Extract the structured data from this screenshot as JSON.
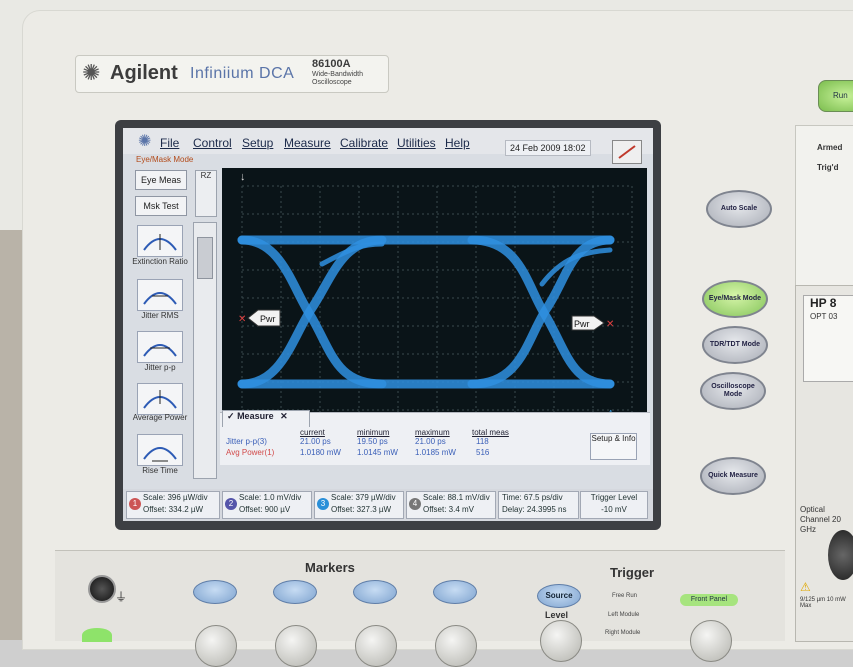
{
  "brand": {
    "company": "Agilent",
    "line": "Infiniium DCA",
    "model": "86100A",
    "model_desc": "Wide-Bandwidth Oscilloscope"
  },
  "menu": [
    "File",
    "Control",
    "Setup",
    "Measure",
    "Calibrate",
    "Utilities",
    "Help"
  ],
  "datetime": "24 Feb 2009  18:02",
  "mode_title": "Eye/Mask Mode",
  "tools": {
    "eye_meas": "Eye Meas",
    "mask_test": "Msk Test"
  },
  "rz_label": "RZ",
  "measure_buttons": [
    {
      "name": "extinction-ratio",
      "label": "Extinction Ratio"
    },
    {
      "name": "jitter-rms",
      "label": "Jitter RMS"
    },
    {
      "name": "jitter-pp",
      "label": "Jitter p-p"
    },
    {
      "name": "average-power",
      "label": "Average Power"
    },
    {
      "name": "rise-time",
      "label": "Rise Time"
    }
  ],
  "plot": {
    "pwr_marker": "Pwr",
    "trace_color": "#2f8fe0",
    "background": "#0a1418"
  },
  "measure_panel": {
    "tab": "Measure",
    "headers": [
      "current",
      "minimum",
      "maximum",
      "total meas"
    ],
    "rows": [
      {
        "label": "Jitter p-p(3)",
        "current": "21.00 ps",
        "minimum": "19.50 ps",
        "maximum": "21.00 ps",
        "total": "118",
        "color": "#3a5fb8"
      },
      {
        "label": "Avg Power(1)",
        "current": "1.0180 mW",
        "minimum": "1.0145 mW",
        "maximum": "1.0185 mW",
        "total": "516",
        "color": "#d24a4a"
      }
    ],
    "setup_info": "Setup & Info"
  },
  "channels": [
    {
      "num": "1",
      "scale": "Scale: 396 µW/div",
      "offset": "Offset: 334.2 µW",
      "color": "#c55"
    },
    {
      "num": "2",
      "scale": "Scale: 1.0 mV/div",
      "offset": "Offset: 900 µV",
      "color": "#55a"
    },
    {
      "num": "3",
      "scale": "Scale: 379 µW/div",
      "offset": "Offset: 327.3 µW",
      "color": "#2a8fd8"
    },
    {
      "num": "4",
      "scale": "Scale: 88.1 mV/div",
      "offset": "Offset: 3.4 mV",
      "color": "#777"
    }
  ],
  "timebase": {
    "time": "Time: 67.5 ps/div",
    "delay": "Delay: 24.3995 ns"
  },
  "trigger_level": {
    "label": "Trigger Level",
    "value": "-10 mV"
  },
  "right_buttons": {
    "auto_scale": "Auto Scale",
    "eye_mask": "Eye/Mask Mode",
    "tdr": "TDR/TDT Mode",
    "osc": "Oscilloscope Mode",
    "quick": "Quick Measure"
  },
  "right_panel": {
    "armed": "Armed",
    "trigd": "Trig'd",
    "run": "Run"
  },
  "hp_module": {
    "title": "HP 8",
    "opt": "OPT 03",
    "optical_channel": "Optical Channel 20 GHz",
    "warning": "9/125 µm 10 mW Max"
  },
  "front_panel": {
    "markers": "Markers",
    "trigger": "Trigger",
    "source": "Source",
    "level": "Level",
    "free_run": "Free Run",
    "left_module": "Left Module",
    "right_module": "Right Module",
    "front_panel": "Front Panel"
  }
}
